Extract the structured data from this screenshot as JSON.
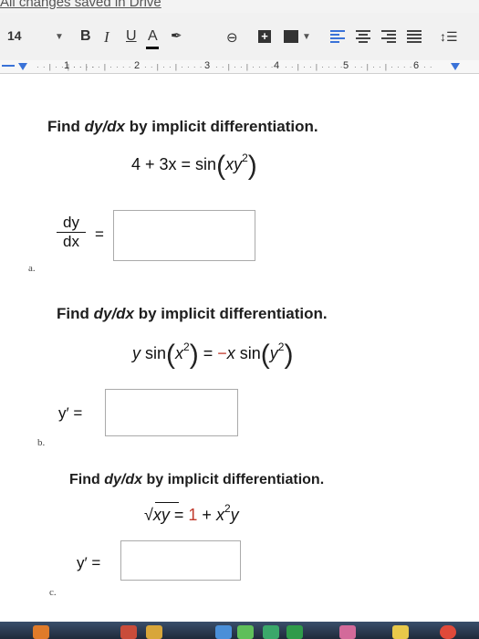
{
  "status": {
    "text": "All changes saved in Drive"
  },
  "toolbar": {
    "font_size": "14",
    "bold": "B",
    "italic": "I",
    "underline": "U",
    "text_color": "A",
    "comment": "+"
  },
  "ruler": {
    "numbers": [
      "1",
      "2",
      "3",
      "4",
      "5",
      "6"
    ]
  },
  "questions": {
    "a": {
      "prompt_before": "Find ",
      "prompt_em": "dy/dx",
      "prompt_after": " by implicit differentiation.",
      "eq_left": "4 + 3x = sin",
      "eq_arg": "xy",
      "eq_exp": "2",
      "answer_num": "dy",
      "answer_den": "dx",
      "equals": "=",
      "label": "a.",
      "answer_value": ""
    },
    "b": {
      "prompt_before": "Find ",
      "prompt_em": "dy/dx",
      "prompt_after": " by implicit differentiation.",
      "eq_y": "y",
      "eq_sin1": " sin",
      "eq_x": "x",
      "eq_exp1": "2",
      "eq_mid": " = ",
      "eq_neg": "−",
      "eq_x2": "x",
      "eq_sin2": " sin",
      "eq_y2": "y",
      "eq_exp2": "2",
      "answer_label": "y′ =",
      "label": "b.",
      "answer_value": ""
    },
    "c": {
      "prompt_before": "Find ",
      "prompt_em": "dy/dx",
      "prompt_after": " by implicit differentiation.",
      "sqrt_sign": "√",
      "sqrt_arg": "xy",
      "eq_equals": " = ",
      "eq_one": "1",
      "eq_plus": " + ",
      "eq_x": "x",
      "eq_exp": "2",
      "eq_y": "y",
      "answer_label": "y′ =",
      "label": "c.",
      "answer_value": ""
    }
  },
  "colors": {
    "accent_blue": "#3a72d8",
    "constant_red": "#c0392b",
    "page": "#ffffff"
  }
}
